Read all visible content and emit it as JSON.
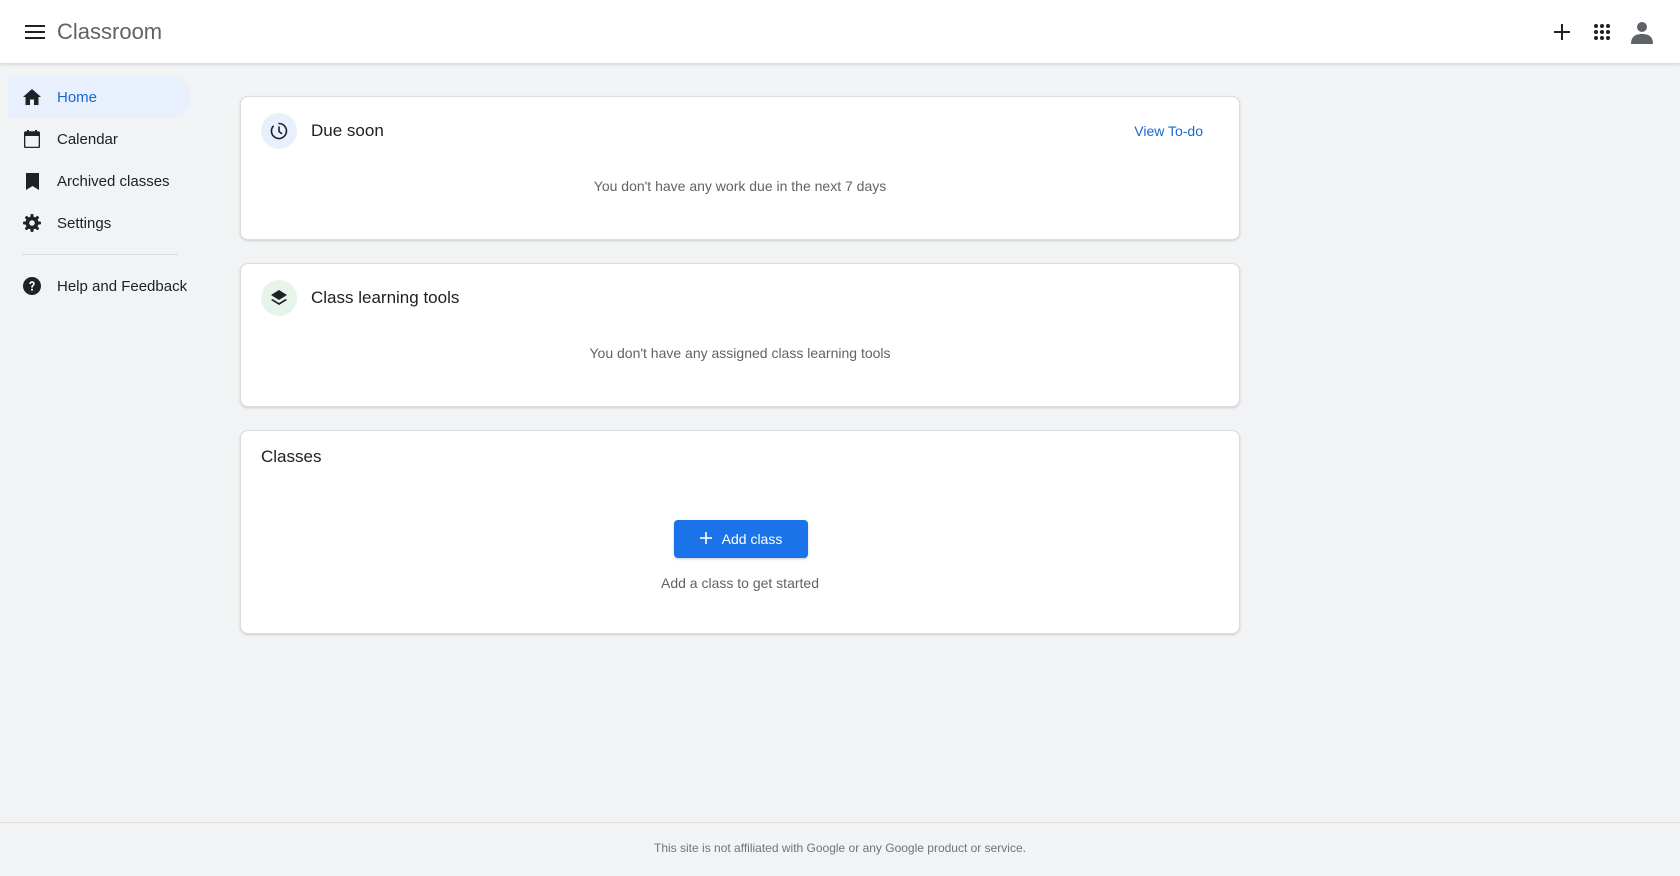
{
  "header": {
    "title": "Classroom",
    "menu_icon": "hamburger-menu-icon",
    "actions": [
      "plus-icon",
      "apps-grid-icon",
      "account-icon"
    ]
  },
  "sidebar": {
    "items": [
      {
        "label": "Home",
        "icon": "home-icon",
        "active": true
      },
      {
        "label": "Calendar",
        "icon": "calendar-icon",
        "active": false
      },
      {
        "label": "Archived classes",
        "icon": "bookmark-icon",
        "active": false
      },
      {
        "label": "Settings",
        "icon": "gear-icon",
        "active": false
      }
    ],
    "help": {
      "label": "Help and Feedback",
      "icon": "help-icon"
    }
  },
  "due_soon": {
    "title": "Due soon",
    "link": "View To-do",
    "empty": "You don't have any work due in the next 7 days"
  },
  "learning_tools": {
    "title": "Class learning tools",
    "empty": "You don't have any assigned class learning tools"
  },
  "classes": {
    "title": "Classes",
    "add_button": "Add class",
    "hint": "Add a class to get started"
  },
  "footer": {
    "text": "This site is not affiliated with Google or any Google product or service."
  },
  "colors": {
    "accent": "#1a73e8",
    "active_bg": "#e8f0fe",
    "link": "#1967d2"
  }
}
